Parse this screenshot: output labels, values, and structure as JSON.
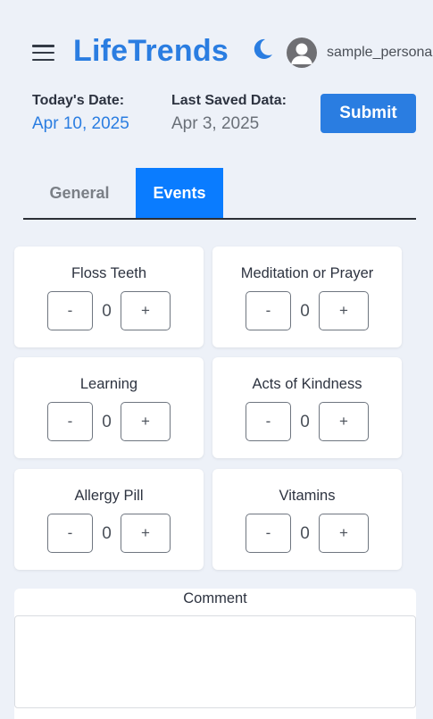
{
  "header": {
    "app_title": "LifeTrends",
    "username": "sample_persona",
    "accent_color": "#2a7de1"
  },
  "dates": {
    "today_label": "Today's Date:",
    "today_value": "Apr 10, 2025",
    "saved_label": "Last Saved Data:",
    "saved_value": "Apr 3, 2025"
  },
  "submit_label": "Submit",
  "tabs": [
    {
      "label": "General",
      "active": false
    },
    {
      "label": "Events",
      "active": true
    }
  ],
  "events": [
    {
      "title": "Floss Teeth",
      "count": "0",
      "minus": "-",
      "plus": "+"
    },
    {
      "title": "Meditation or Prayer",
      "count": "0",
      "minus": "-",
      "plus": "+"
    },
    {
      "title": "Learning",
      "count": "0",
      "minus": "-",
      "plus": "+"
    },
    {
      "title": "Acts of Kindness",
      "count": "0",
      "minus": "-",
      "plus": "+"
    },
    {
      "title": "Allergy Pill",
      "count": "0",
      "minus": "-",
      "plus": "+"
    },
    {
      "title": "Vitamins",
      "count": "0",
      "minus": "-",
      "plus": "+"
    }
  ],
  "comment": {
    "label": "Comment",
    "value": ""
  },
  "icons": {
    "menu": "menu-icon",
    "theme": "moon-icon",
    "avatar": "user-avatar-icon"
  }
}
